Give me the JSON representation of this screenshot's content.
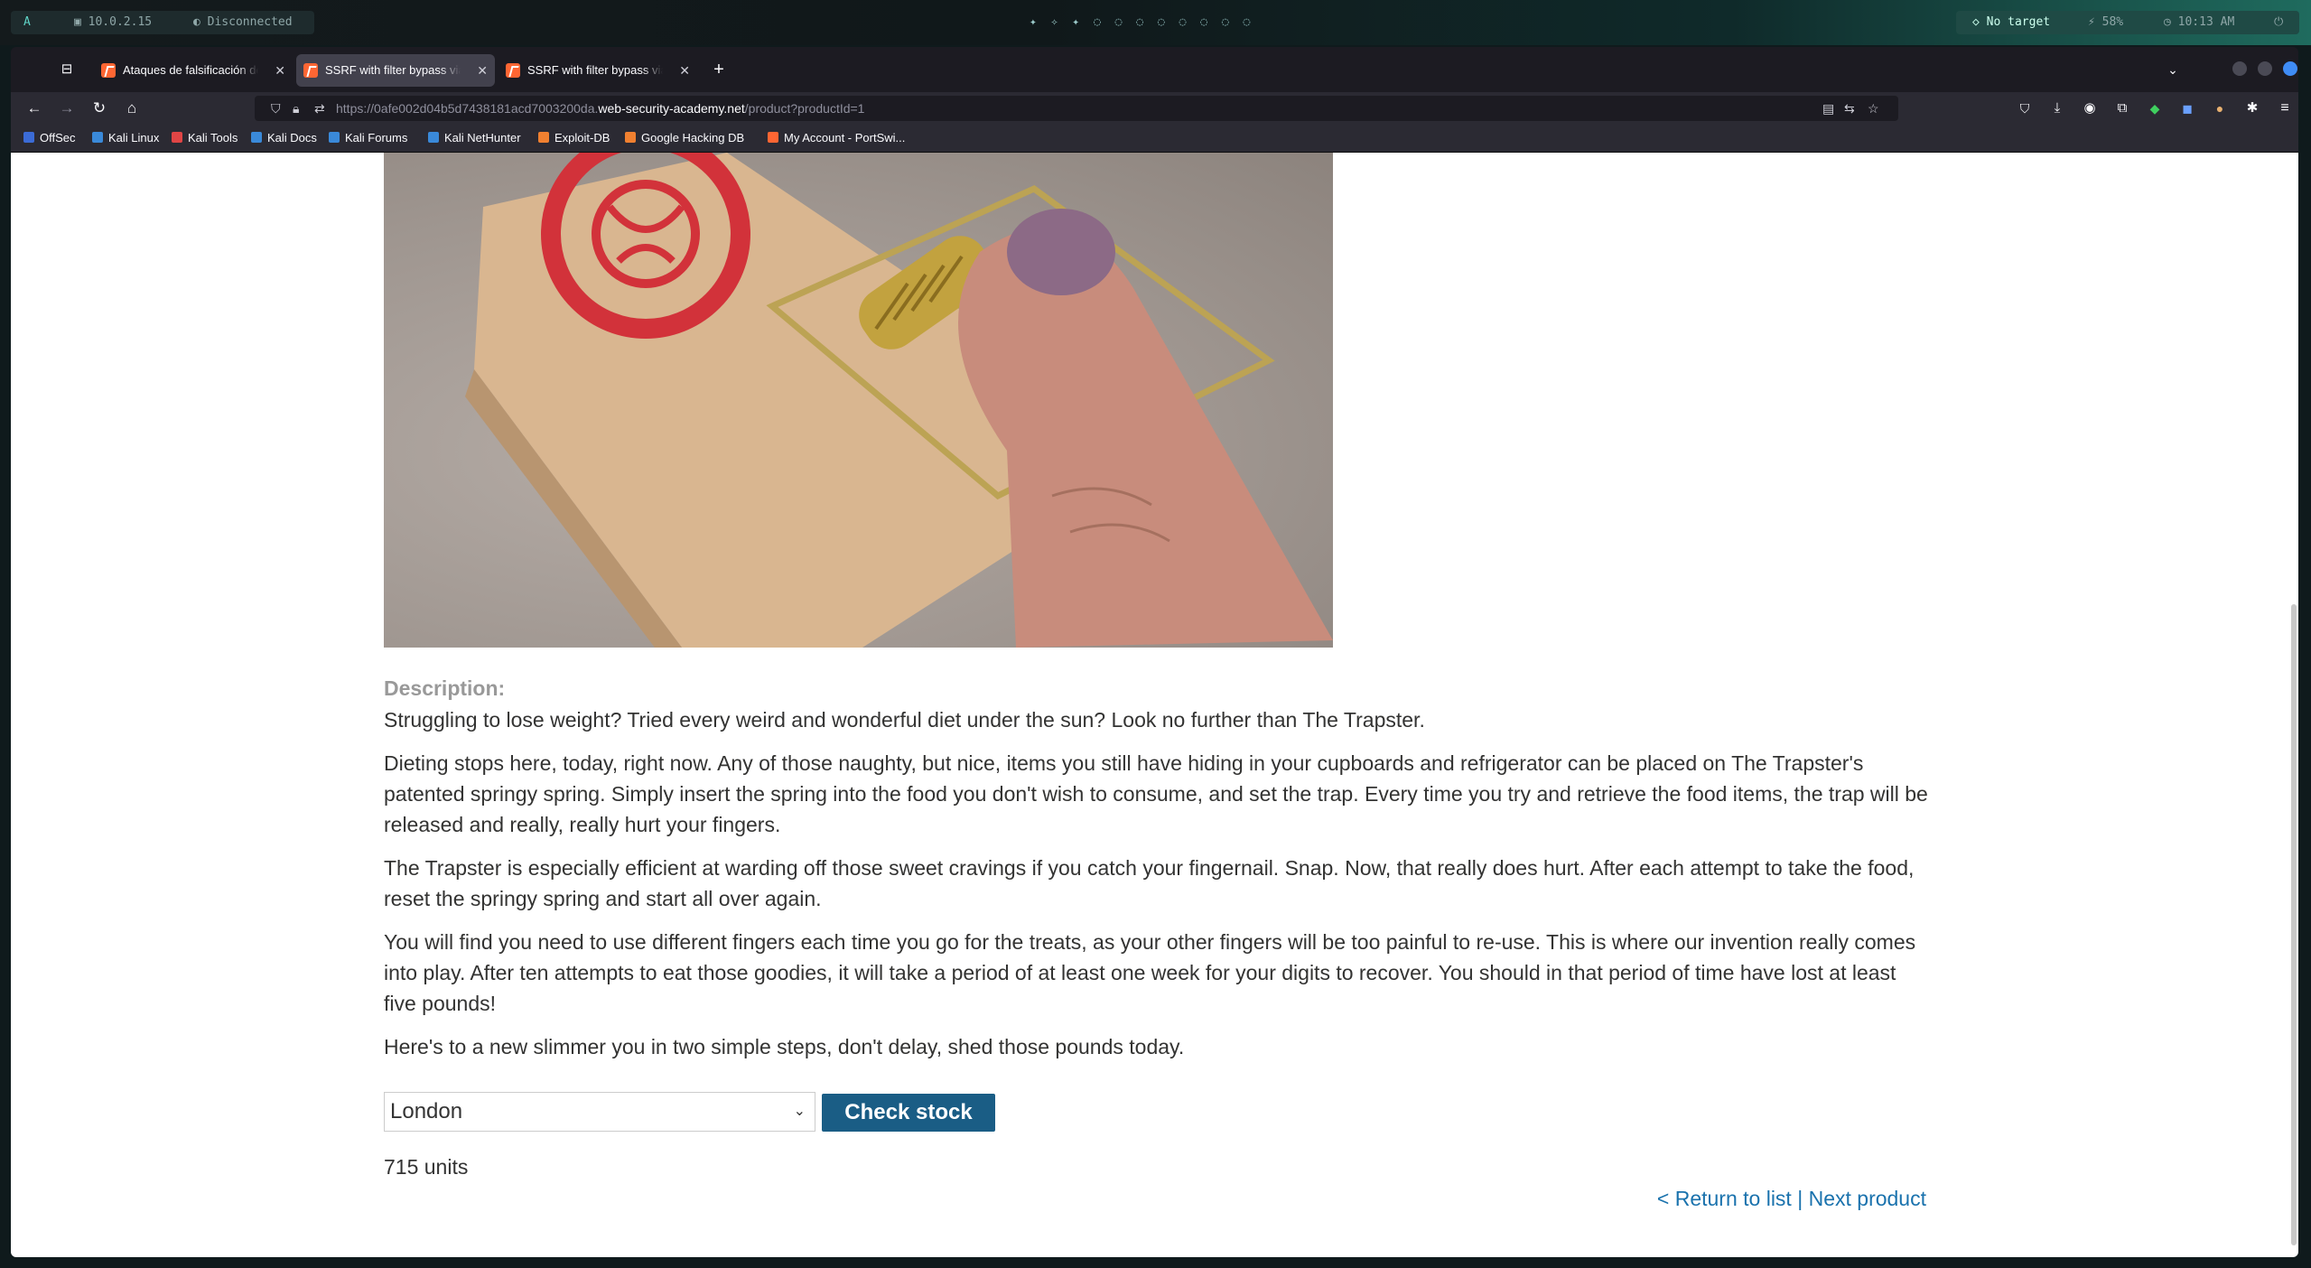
{
  "desktop": {
    "workspace": "A",
    "ip": "10.0.2.15",
    "vpn_status": "Disconnected",
    "target": "No target",
    "battery": "58%",
    "clock": "10:13 AM"
  },
  "tabs": [
    {
      "title": "Ataques de falsificación de",
      "active": false
    },
    {
      "title": "SSRF with filter bypass via",
      "active": true
    },
    {
      "title": "SSRF with filter bypass via",
      "active": false
    }
  ],
  "url": {
    "prefix": "https://0afe002d04b5d7438181acd7003200da.",
    "domain": "web-security-academy.net",
    "path": "/product?productId=1"
  },
  "bookmarks": [
    {
      "label": "OffSec",
      "color": "#3b6bd6"
    },
    {
      "label": "Kali Linux",
      "color": "#3a89d9"
    },
    {
      "label": "Kali Tools",
      "color": "#e04545"
    },
    {
      "label": "Kali Docs",
      "color": "#3a89d9"
    },
    {
      "label": "Kali Forums",
      "color": "#3a89d9"
    },
    {
      "label": "Kali NetHunter",
      "color": "#3a89d9"
    },
    {
      "label": "Exploit-DB",
      "color": "#f08030"
    },
    {
      "label": "Google Hacking DB",
      "color": "#f08030"
    },
    {
      "label": "My Account - PortSwi...",
      "color": "#ff6633"
    }
  ],
  "product": {
    "description_label": "Description:",
    "paragraphs": [
      "Struggling to lose weight? Tried every weird and wonderful diet under the sun? Look no further than The Trapster.",
      "Dieting stops here, today, right now. Any of those naughty, but nice, items you still have hiding in your cupboards and refrigerator can be placed on The Trapster's patented springy spring. Simply insert the spring into the food you don't wish to consume, and set the trap. Every time you try and retrieve the food items, the trap will be released and really, really hurt your fingers.",
      "The Trapster is especially efficient at warding off those sweet cravings if you catch your fingernail. Snap. Now, that really does hurt. After each attempt to take the food, reset the springy spring and start all over again.",
      "You will find you need to use different fingers each time you go for the treats, as your other fingers will be too painful to re-use. This is where our invention really comes into play. After ten attempts to eat those goodies, it will take a period of at least one week for your digits to recover. You should in that period of time have lost at least five pounds!",
      "Here's to a new slimmer you in two simple steps, don't delay, shed those pounds today."
    ],
    "stock_select_value": "London",
    "check_stock_label": "Check stock",
    "stock_result": "715 units",
    "return_link": "< Return to list",
    "separator": "|",
    "next_link": "Next product"
  },
  "colors": {
    "button_bg": "#1a5d85",
    "link": "#1a72ad",
    "favicon": "#ff6633"
  }
}
